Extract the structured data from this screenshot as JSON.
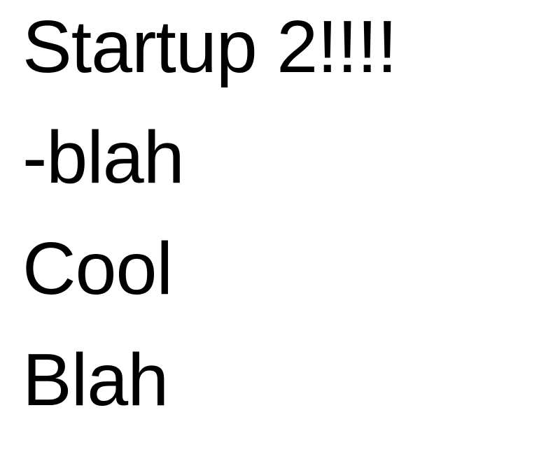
{
  "document": {
    "lines": [
      "Startup 2!!!!",
      "-blah",
      "Cool",
      "Blah"
    ],
    "text_color": "#000000",
    "background_color": "#ffffff"
  }
}
